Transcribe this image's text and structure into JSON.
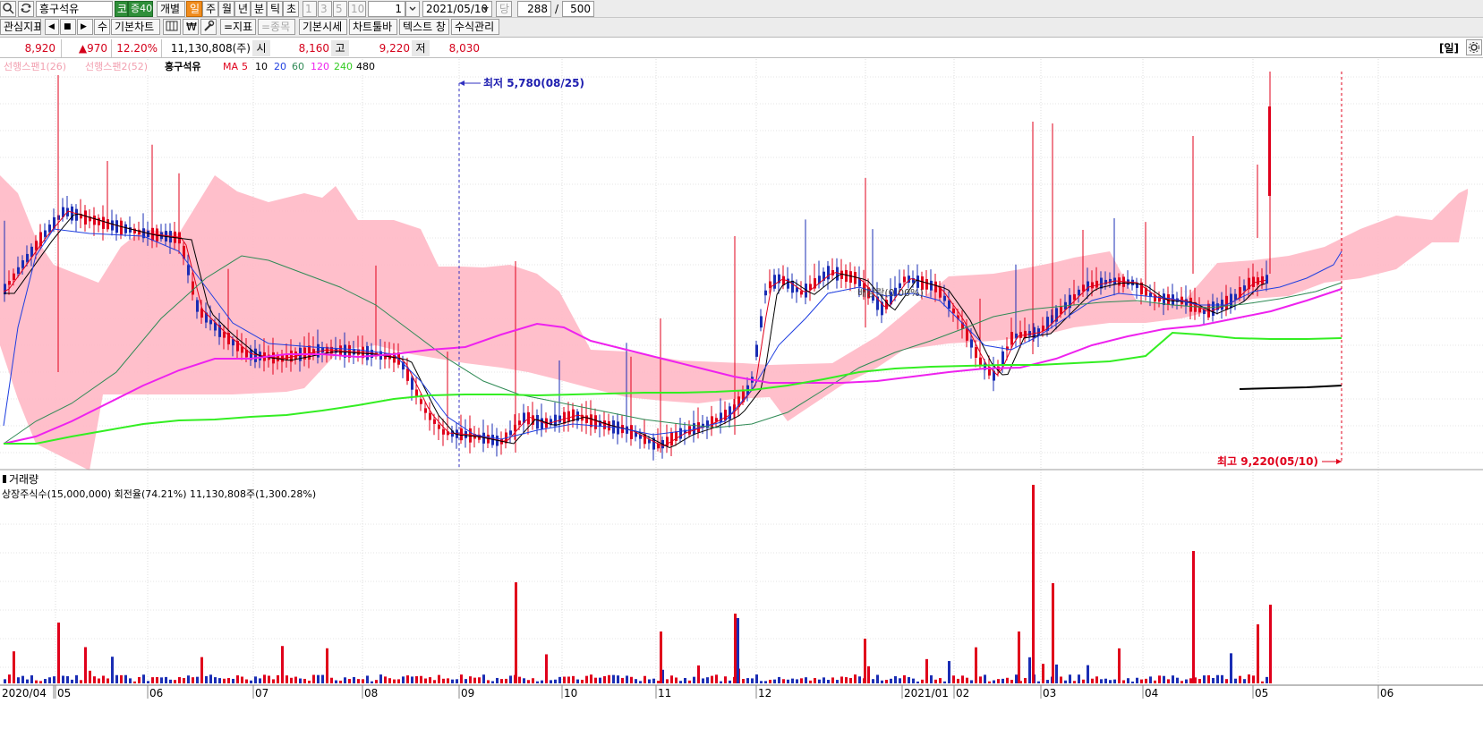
{
  "toolbar": {
    "search_icon": "search-icon",
    "refresh_icon": "refresh-icon",
    "stock_name": "흥구석유",
    "market_badge": "코",
    "margin_badge": "증40",
    "btn_individual": "개별",
    "periods": [
      "일",
      "주",
      "월",
      "년",
      "분",
      "틱",
      "초"
    ],
    "period_numbers": [
      "1",
      "3",
      "5",
      "10"
    ],
    "period_value": "1",
    "date_value": "2021/05/10",
    "date_suffix": "당",
    "count_value": "288",
    "count_sep": "/",
    "count_total": "500",
    "row2": {
      "interest": "관심지표",
      "nav_left": "◀",
      "nav_mid": "■",
      "nav_right": "▶",
      "btn_su": "수",
      "basic_chart": "기본차트",
      "btn_won": "₩",
      "add_indicator": "=지표",
      "add_stock": "=종목",
      "basic_quote": "기본시세",
      "chart_toolbar": "차트툴바",
      "text_window": "텍스트 창",
      "formula_mgmt": "수식관리"
    }
  },
  "quote": {
    "price": "8,920",
    "change": "▲970",
    "change_rate": "12.20%",
    "volume": "11,130,808(주)",
    "open_label": "시",
    "open": "8,160",
    "high_label": "고",
    "high": "9,220",
    "low_label": "저",
    "low": "8,030",
    "period_badge": "[일]"
  },
  "price_panel": {
    "legend": {
      "ichimoku1": "선행스팬1(26)",
      "ichimoku2": "선행스팬2(52)",
      "name": "흥구석유",
      "ma_prefix": "MA",
      "ma_periods": [
        "5",
        "10",
        "20",
        "60",
        "120",
        "240",
        "480"
      ]
    },
    "low_annotation": "최저 5,780(08/25)",
    "high_annotation": "최고 9,220(05/10)",
    "dividend_label": "배당락(0.00%)"
  },
  "volume_panel": {
    "title": "거래량",
    "info": "상장주식수(15,000,000) 회전율(74.21%) 11,130,808주(1,300.28%)"
  },
  "x_axis": {
    "labels": [
      "2020/04",
      "05",
      "06",
      "07",
      "08",
      "09",
      "10",
      "11",
      "12",
      "2021/01",
      "02",
      "03",
      "04",
      "05",
      "06"
    ]
  },
  "colors": {
    "up": "#e0001b",
    "down": "#1a2db4",
    "ma5": "#e0001b",
    "ma10": "#000000",
    "ma20": "#1f3fe0",
    "ma60": "#2f8a55",
    "ma120": "#ee22ee",
    "ma240": "#33ee22",
    "ma480": "#000000",
    "cloud": "#ffbcc8",
    "quote_up": "#d4001a"
  },
  "chart_data": {
    "type": "candlestick",
    "series": [
      {
        "name": "흥구석유",
        "approx_range": [
          5780,
          9220
        ]
      },
      {
        "name": "5"
      },
      {
        "name": "10"
      },
      {
        "name": "20"
      },
      {
        "name": "60"
      },
      {
        "name": "120"
      },
      {
        "name": "240"
      },
      {
        "name": "480"
      }
    ],
    "notes": [
      "최저 5,780(08/25)",
      "최고 9,220(05/10)"
    ]
  }
}
